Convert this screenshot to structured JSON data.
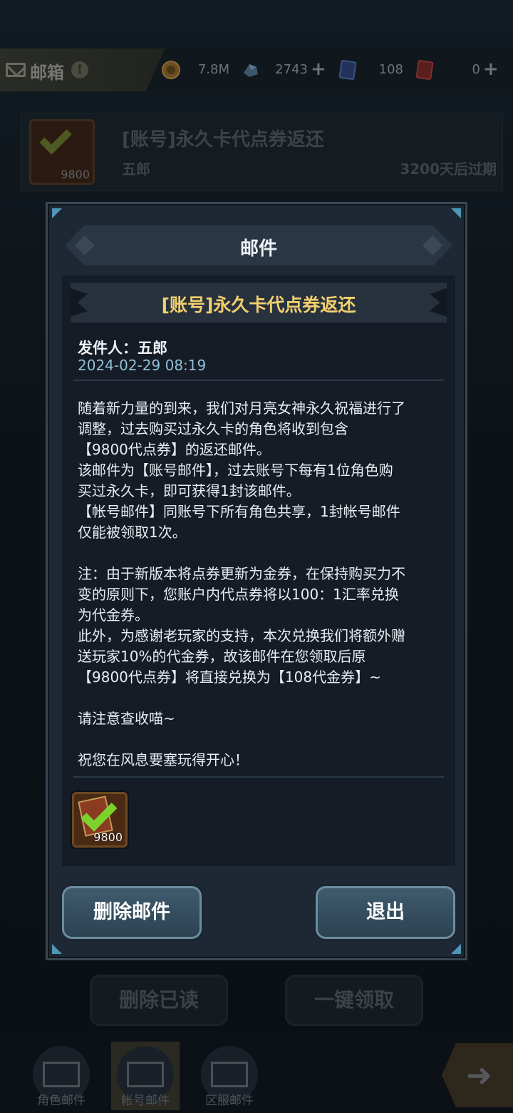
{
  "top_bar": {
    "title": "邮箱",
    "info_label": "!",
    "resources": [
      {
        "name": "gold",
        "icon": "coin-icon",
        "value": "7.8M"
      },
      {
        "name": "crystal",
        "icon": "crystal-icon",
        "value": "2743",
        "plus": "+"
      },
      {
        "name": "voucher",
        "icon": "voucher-card-icon",
        "value": "108"
      },
      {
        "name": "gold-ticket",
        "icon": "gold-ticket-icon",
        "value": "0",
        "plus": "+"
      }
    ]
  },
  "background_mail_item": {
    "title": "[账号]永久卡代点券返还",
    "sender": "五郎",
    "expire": "3200天后过期",
    "icon_count": "9800"
  },
  "background_buttons": {
    "delete_read": "删除已读",
    "claim_all": "一键领取"
  },
  "bottom_tabs": [
    {
      "label": "角色邮件",
      "icon": "envelope-icon"
    },
    {
      "label": "帐号邮件",
      "icon": "account-mail-icon"
    },
    {
      "label": "区服邮件",
      "icon": "server-mail-icon"
    }
  ],
  "modal": {
    "title": "邮件",
    "subject": "[账号]永久卡代点券返还",
    "sender_line": "发件人：五郎",
    "date": "2024-02-29 08:19",
    "body": [
      "随着新力量的到来，我们对月亮女神永久祝福进行了",
      "调整，过去购买过永久卡的角色将收到包含",
      "【9800代点券】的返还邮件。",
      "该邮件为【账号邮件】，过去账号下每有1位角色购",
      "买过永久卡，即可获得1封该邮件。",
      "【帐号邮件】同账号下所有角色共享，1封帐号邮件",
      "仅能被领取1次。",
      "",
      "注：由于新版本将点券更新为金券，在保持购买力不",
      "变的原则下，您账户内代点券将以100：1汇率兑换",
      "为代金券。",
      "此外，为感谢老玩家的支持，本次兑换我们将额外赠",
      "送玩家10%的代金券，故该邮件在您领取后原",
      "【9800代点券】将直接兑换为【108代金券】~",
      "",
      "请注意查收喵~",
      "",
      "祝您在风息要塞玩得开心！"
    ],
    "attachment": {
      "icon": "voucher-checked-icon",
      "count": "9800"
    },
    "delete_button": "删除邮件",
    "exit_button": "退出"
  },
  "colors": {
    "subject": "#f2cf6e",
    "date": "#8fbfd8",
    "accent": "#4f97b8"
  }
}
